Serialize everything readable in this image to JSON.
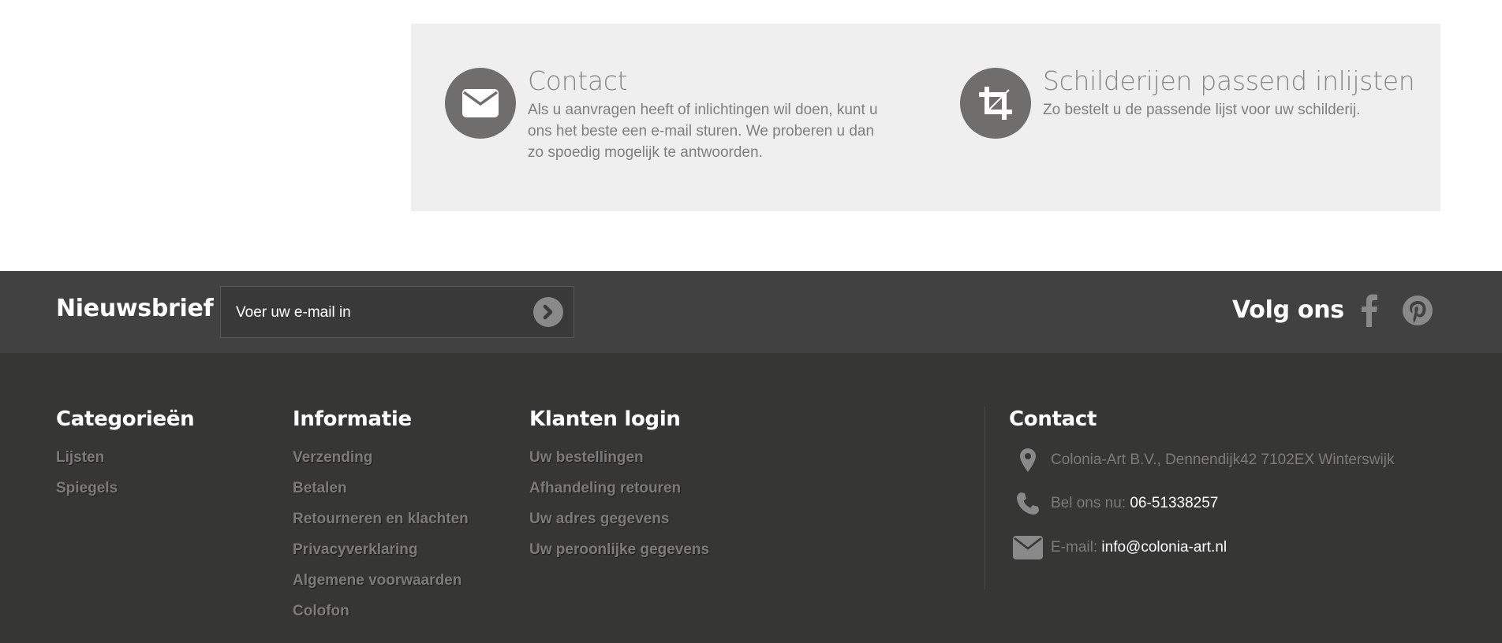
{
  "info_box": {
    "contact": {
      "title": "Contact",
      "description": "Als u aanvragen heeft of inlichtingen wil doen, kunt u ons het beste een e-mail sturen. We proberen u dan zo spoedig mogelijk te antwoorden.",
      "icon": "envelope-icon"
    },
    "framing": {
      "title": "Schilderijen passend inlijsten",
      "description": "Zo bestelt u de passende lijst voor uw schilderij.",
      "icon": "crop-icon"
    }
  },
  "newsletter": {
    "label": "Nieuwsbrief",
    "placeholder": "Voer uw e-mail in",
    "submit_icon": "chevron-right-circle-icon"
  },
  "social": {
    "label": "Volg ons",
    "icons": [
      "facebook-icon",
      "pinterest-icon"
    ]
  },
  "footer": {
    "categories": {
      "title": "Categorieën",
      "items": [
        "Lijsten",
        "Spiegels"
      ]
    },
    "information": {
      "title": "Informatie",
      "items": [
        "Verzending",
        "Betalen",
        "Retourneren en klachten",
        "Privacyverklaring",
        "Algemene voorwaarden",
        "Colofon"
      ]
    },
    "customer_login": {
      "title": "Klanten login",
      "items": [
        "Uw bestellingen",
        "Afhandeling retouren",
        "Uw adres gegevens",
        "Uw peroonlijke gegevens"
      ]
    },
    "contact": {
      "title": "Contact",
      "address": "Colonia-Art B.V., Dennendijk42 7102EX Winterswijk",
      "phone_label": "Bel ons nu:",
      "phone": "06-51338257",
      "email_label": "E-mail:",
      "email": "info@colonia-art.nl"
    }
  },
  "colors": {
    "info_box_bg": "#efefef",
    "icon_circle": "#706e6c",
    "newsletter_bar": "#424141",
    "footer_bg": "#363635",
    "link_grey": "#7c7b7a"
  }
}
